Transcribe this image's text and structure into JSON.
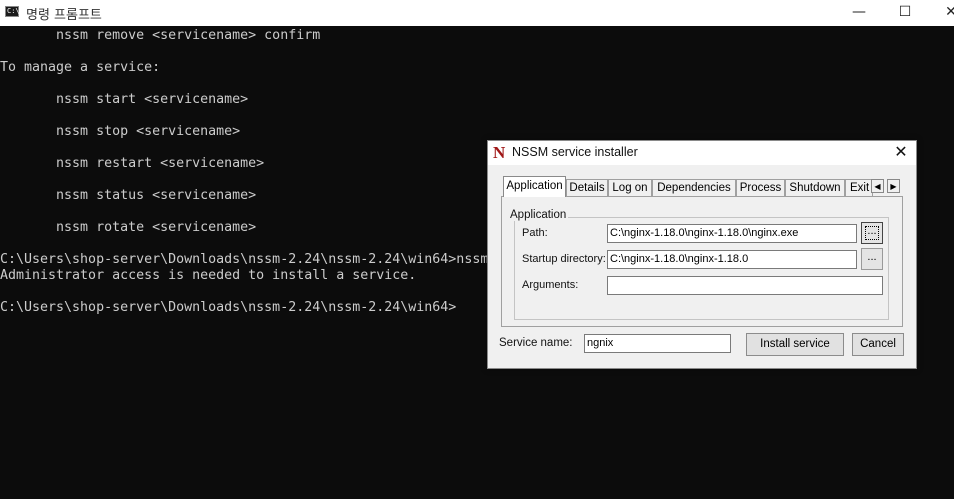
{
  "window": {
    "title": "명령 프롬프트",
    "icon_text": "C:\\",
    "controls": {
      "minimize": "—",
      "maximize": "☐",
      "close": "✕"
    }
  },
  "console": {
    "lines": [
      "       nssm remove <servicename> confirm",
      "To manage a service:",
      "       nssm start <servicename>",
      "       nssm stop <servicename>",
      "       nssm restart <servicename>",
      "       nssm status <servicename>",
      "       nssm rotate <servicename>",
      "C:\\Users\\shop-server\\Downloads\\nssm-2.24\\nssm-2.24\\win64>nssm",
      "Administrator access is needed to install a service.",
      "C:\\Users\\shop-server\\Downloads\\nssm-2.24\\nssm-2.24\\win64>"
    ]
  },
  "dialog": {
    "logo": "N",
    "title": "NSSM service installer",
    "close": "✕",
    "tabs": [
      "Application",
      "Details",
      "Log on",
      "Dependencies",
      "Process",
      "Shutdown",
      "Exit"
    ],
    "tab_scroll": {
      "left": "◀",
      "right": "▶"
    },
    "group_label": "Application",
    "path_label": "Path:",
    "path_value": "C:\\nginx-1.18.0\\nginx-1.18.0\\nginx.exe",
    "startup_label": "Startup directory:",
    "startup_value": "C:\\nginx-1.18.0\\nginx-1.18.0",
    "arguments_label": "Arguments:",
    "arguments_value": "",
    "browse_label": "...",
    "service_name_label": "Service name:",
    "service_name_value": "ngnix",
    "install_button": "Install service",
    "cancel_button": "Cancel"
  }
}
